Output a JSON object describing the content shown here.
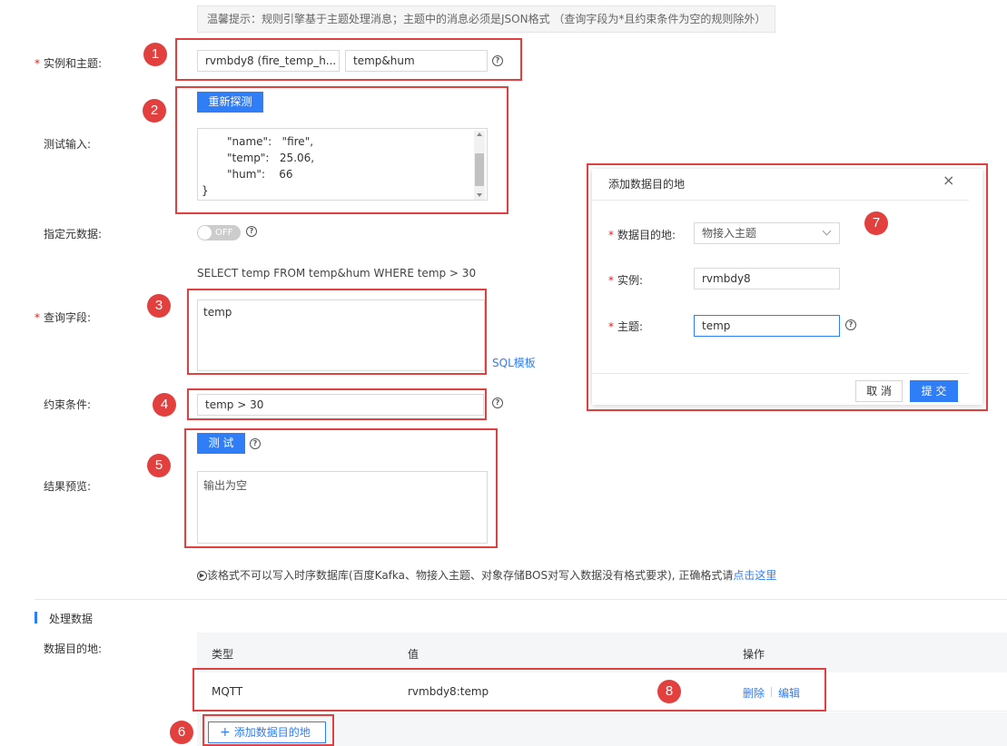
{
  "notice": "温馨提示：规则引擎基于主题处理消息；主题中的消息必须是JSON格式 （查询字段为*且约束条件为空的规则除外）",
  "form": {
    "instance_topic_label": "实例和主题:",
    "instance_value": "rvmbdy8 (fire_temp_h...",
    "topic_value": "temp&hum",
    "redetect_label": "重新探测",
    "test_input_label": "测试输入:",
    "test_input_lines": [
      "\"name\":   \"fire\",",
      "\"temp\":   25.06,",
      "\"hum\":    66"
    ],
    "test_input_close": "}",
    "meta_label": "指定元数据:",
    "toggle_text": "OFF",
    "sql_statement": "SELECT temp FROM temp&hum WHERE temp > 30",
    "query_label": "查询字段:",
    "query_value": "temp",
    "sql_template_link": "SQL模板",
    "condition_label": "约束条件:",
    "condition_value": "temp > 30",
    "test_button": "测 试",
    "preview_label": "结果预览:",
    "preview_value": "输出为空",
    "format_note_prefix": "该格式不可以写入时序数据库(百度Kafka、物接入主题、对象存储BOS对写入数据没有格式要求), 正确格式请",
    "format_note_link": "点击这里"
  },
  "process": {
    "section_title": "处理数据",
    "dest_label": "数据目的地:",
    "columns": [
      "类型",
      "值",
      "操作"
    ],
    "rows": [
      {
        "type": "MQTT",
        "value": "rvmbdy8:temp",
        "delete": "删除",
        "edit": "编辑"
      }
    ],
    "add_button": "添加数据目的地"
  },
  "modal": {
    "title": "添加数据目的地",
    "dest_label": "数据目的地:",
    "dest_value": "物接入主题",
    "instance_label": "实例:",
    "instance_value": "rvmbdy8",
    "topic_label": "主题:",
    "topic_value": "temp",
    "cancel": "取 消",
    "submit": "提 交"
  },
  "badges": [
    "1",
    "2",
    "3",
    "4",
    "5",
    "6",
    "7",
    "8"
  ],
  "colors": {
    "accent": "#2f7df7",
    "annotation": "#e2403e"
  }
}
